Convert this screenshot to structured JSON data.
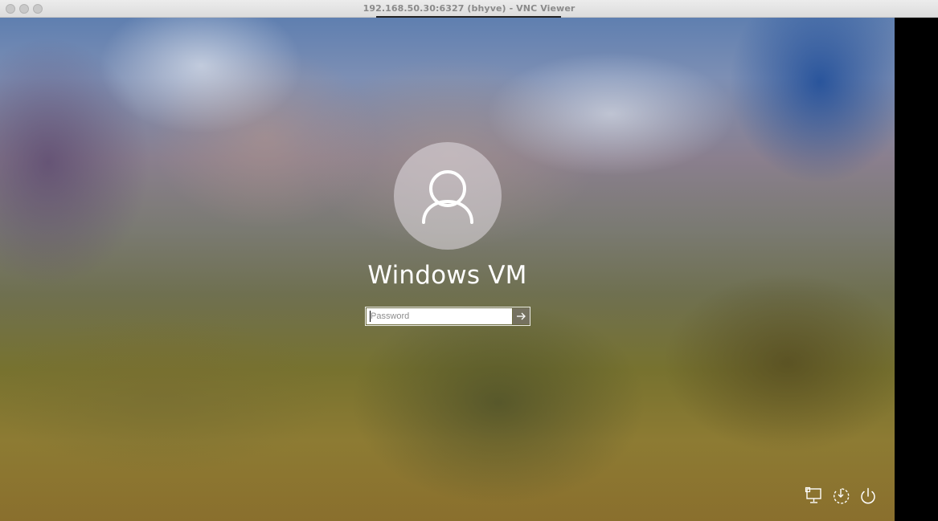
{
  "window": {
    "title": "192.168.50.30:6327 (bhyve) - VNC Viewer"
  },
  "lockscreen": {
    "user_name": "Windows VM",
    "password": {
      "placeholder": "Password",
      "value": ""
    },
    "icons": {
      "avatar": "user-icon",
      "submit": "arrow-right-icon",
      "network": "network-icon",
      "accessibility": "ease-of-access-icon",
      "power": "power-icon"
    }
  },
  "colors": {
    "text": "#ffffff",
    "input_bg": "#ffffff",
    "placeholder": "#8d8d8d"
  }
}
